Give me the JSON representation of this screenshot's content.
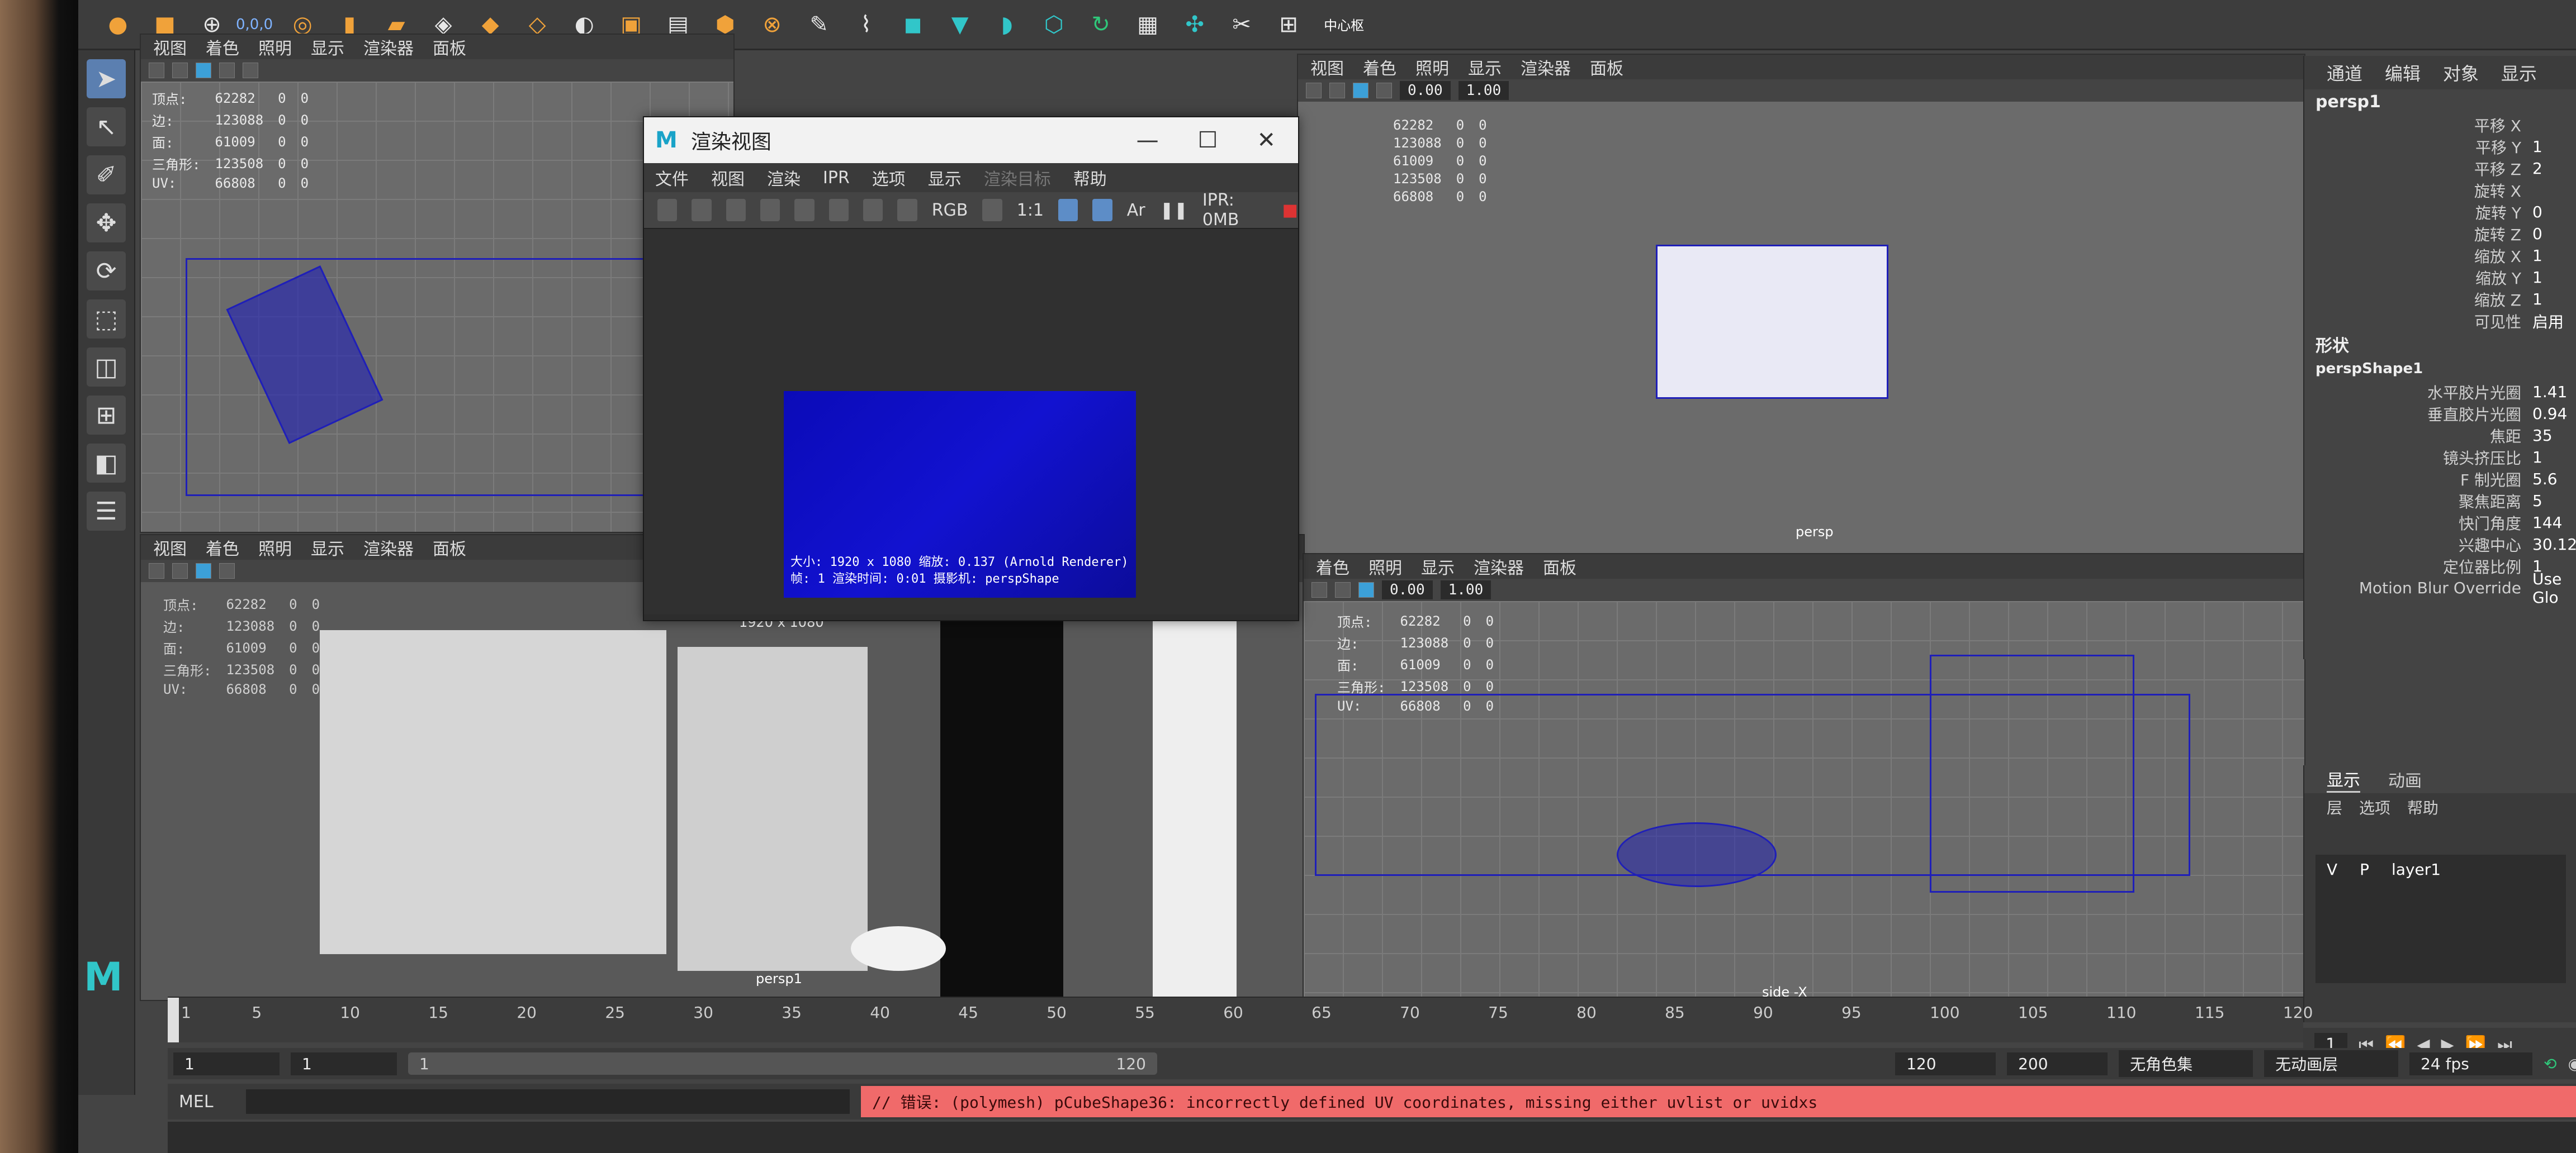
{
  "shelf": {
    "xyz_readout": "0,0,0",
    "center_pivot_label": "中心枢"
  },
  "viewport_menu": [
    "视图",
    "着色",
    "照明",
    "显示",
    "渲染器",
    "面板"
  ],
  "viewport_toolbar": {
    "value_a": "0.00",
    "value_b": "1.00"
  },
  "hud": {
    "labels": [
      "顶点:",
      "边:",
      "面:",
      "三角形:",
      "UV:"
    ],
    "values": [
      "62282",
      "123088",
      "61009",
      "123508",
      "66808"
    ],
    "zeros": [
      "0",
      "0"
    ]
  },
  "viewports": {
    "top_left": {
      "label": ""
    },
    "top_right": {
      "label": "persp"
    },
    "bottom_left": {
      "label": "persp1",
      "resolution": "1920 x 1080"
    },
    "bottom_right": {
      "label": "side -X"
    }
  },
  "render_view": {
    "title": "渲染视图",
    "menu": [
      "文件",
      "视图",
      "渲染",
      "IPR",
      "选项",
      "显示",
      "渲染目标",
      "帮助"
    ],
    "ratio_label": "1:1",
    "rgb_label": "RGB",
    "ar_label": "Ar",
    "ipr_label": "IPR: 0MB",
    "info_line1": "大小: 1920 x 1080 缩放: 0.137      (Arnold Renderer)",
    "info_line2": "帧: 1     渲染时间: 0:01      摄影机: perspShape"
  },
  "channel_box": {
    "menu": [
      "通道",
      "编辑",
      "对象",
      "显示"
    ],
    "object_name": "persp1",
    "transform_rows": [
      {
        "label": "平移 X",
        "value": ""
      },
      {
        "label": "平移 Y",
        "value": "1"
      },
      {
        "label": "平移 Z",
        "value": "2"
      },
      {
        "label": "旋转 X",
        "value": ""
      },
      {
        "label": "旋转 Y",
        "value": "0"
      },
      {
        "label": "旋转 Z",
        "value": "0"
      },
      {
        "label": "缩放 X",
        "value": "1"
      },
      {
        "label": "缩放 Y",
        "value": "1"
      },
      {
        "label": "缩放 Z",
        "value": "1"
      },
      {
        "label": "可见性",
        "value": "启用"
      }
    ],
    "shapes_header": "形状",
    "shape_name": "perspShape1",
    "shape_rows": [
      {
        "label": "水平胶片光圈",
        "value": "1.41"
      },
      {
        "label": "垂直胶片光圈",
        "value": "0.94"
      },
      {
        "label": "焦距",
        "value": "35"
      },
      {
        "label": "镜头挤压比",
        "value": "1"
      },
      {
        "label": "F 制光圈",
        "value": "5.6"
      },
      {
        "label": "聚焦距离",
        "value": "5"
      },
      {
        "label": "快门角度",
        "value": "144"
      },
      {
        "label": "兴趣中心",
        "value": "30.122"
      },
      {
        "label": "定位器比例",
        "value": "1"
      },
      {
        "label": "Motion Blur Override",
        "value": "Use Glo"
      }
    ]
  },
  "layer_editor": {
    "tabs": [
      "显示",
      "动画"
    ],
    "menu": [
      "层",
      "选项",
      "帮助"
    ],
    "layer": {
      "v": "V",
      "p": "P",
      "name": "layer1"
    }
  },
  "time_slider": {
    "ticks": [
      "1",
      "5",
      "10",
      "15",
      "20",
      "25",
      "30",
      "35",
      "40",
      "45",
      "50",
      "55",
      "60",
      "65",
      "70",
      "75",
      "80",
      "85",
      "90",
      "95",
      "100",
      "105",
      "110",
      "115",
      "120"
    ],
    "current_frame": "1"
  },
  "range_slider": {
    "start": "1",
    "inner_start": "1",
    "bar_start": "1",
    "bar_end": "120",
    "inner_end": "120",
    "end": "200",
    "char_set": "无角色集",
    "anim_layer": "无动画层",
    "fps": "24 fps"
  },
  "command_line": {
    "mel_label": "MEL",
    "error": "// 错误: (polymesh) pCubeShape36: incorrectly defined UV coordinates, missing either uvlist or uvidxs"
  }
}
